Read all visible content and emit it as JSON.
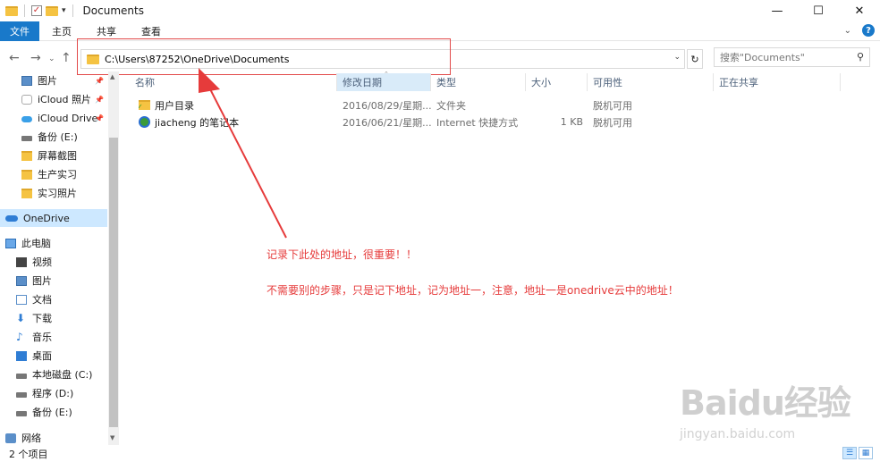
{
  "window": {
    "title": "Documents"
  },
  "ribbon": {
    "file": "文件",
    "tabs": [
      "主页",
      "共享",
      "查看"
    ]
  },
  "address": {
    "path": "C:\\Users\\87252\\OneDrive\\Documents"
  },
  "search": {
    "placeholder": "搜索\"Documents\""
  },
  "sidebar": {
    "items": [
      {
        "label": "图片",
        "icon": "pictures-icon",
        "pinned": true
      },
      {
        "label": "iCloud 照片",
        "icon": "icloud-photos-icon",
        "pinned": true
      },
      {
        "label": "iCloud Drive",
        "icon": "icloud-drive-icon",
        "pinned": true
      },
      {
        "label": "备份 (E:)",
        "icon": "drive-icon"
      },
      {
        "label": "屏幕截图",
        "icon": "folder-icon"
      },
      {
        "label": "生产实习",
        "icon": "folder-icon"
      },
      {
        "label": "实习照片",
        "icon": "folder-icon"
      },
      {
        "label": "OneDrive",
        "icon": "onedrive-icon",
        "selected": true
      },
      {
        "label": "此电脑",
        "icon": "this-pc-icon"
      },
      {
        "label": "视频",
        "icon": "videos-icon"
      },
      {
        "label": "图片",
        "icon": "pictures-icon"
      },
      {
        "label": "文档",
        "icon": "documents-icon"
      },
      {
        "label": "下载",
        "icon": "downloads-icon"
      },
      {
        "label": "音乐",
        "icon": "music-icon"
      },
      {
        "label": "桌面",
        "icon": "desktop-icon"
      },
      {
        "label": "本地磁盘 (C:)",
        "icon": "drive-icon"
      },
      {
        "label": "程序 (D:)",
        "icon": "drive-icon"
      },
      {
        "label": "备份 (E:)",
        "icon": "drive-icon"
      },
      {
        "label": "网络",
        "icon": "network-icon"
      }
    ]
  },
  "columns": [
    "名称",
    "修改日期",
    "类型",
    "大小",
    "可用性",
    "正在共享"
  ],
  "files": [
    {
      "name": "用户目录",
      "date": "2016/08/29/星期...",
      "type": "文件夹",
      "size": "",
      "availability": "脱机可用",
      "icon": "folder-sync-icon"
    },
    {
      "name": "jiacheng 的笔记本",
      "date": "2016/06/21/星期...",
      "type": "Internet 快捷方式",
      "size": "1 KB",
      "availability": "脱机可用",
      "icon": "internet-shortcut-icon"
    }
  ],
  "annotation": {
    "line1": "记录下此处的地址，很重要！！",
    "line2": "不需要别的步骤，只是记下地址，记为地址一，注意，地址一是onedrive云中的地址！",
    "color": "#e63b3b"
  },
  "status": {
    "count": "2 个项目"
  },
  "watermark": {
    "brand": "Baidu经验",
    "url": "jingyan.baidu.com"
  }
}
